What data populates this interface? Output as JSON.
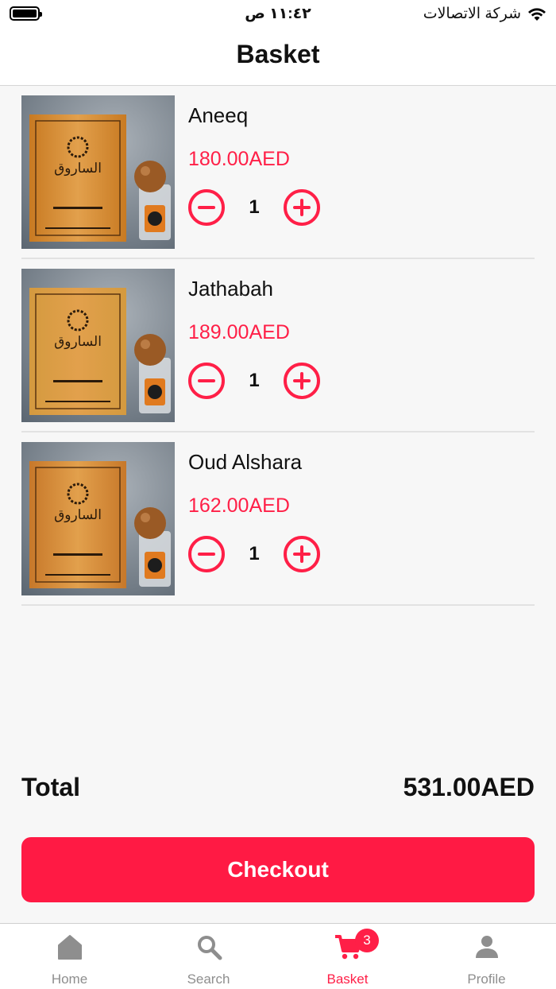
{
  "status_bar": {
    "time": "١١:٤٢ ص",
    "carrier": "شركة الاتصالات"
  },
  "header": {
    "title": "Basket"
  },
  "items": [
    {
      "name": "Aneeq",
      "price": "180.00AED",
      "quantity": "1",
      "box_brand": "ALSAROUQ",
      "box_product": "Aneeq",
      "box_color": "#c87a22"
    },
    {
      "name": "Jathabah",
      "price": "189.00AED",
      "quantity": "1",
      "box_brand": "ALSAROUQ",
      "box_product": "Jathabah",
      "box_color": "#d49a3f"
    },
    {
      "name": "Oud Alshara",
      "price": "162.00AED",
      "quantity": "1",
      "box_brand": "ALSAROUQ",
      "box_product": "Oud Alsahara",
      "box_color": "#c7782a"
    }
  ],
  "summary": {
    "total_label": "Total",
    "total_value": "531.00AED"
  },
  "checkout": {
    "label": "Checkout"
  },
  "tabbar": {
    "tabs": [
      {
        "label": "Home",
        "icon": "home-icon"
      },
      {
        "label": "Search",
        "icon": "search-icon"
      },
      {
        "label": "Basket",
        "icon": "cart-icon",
        "badge": "3"
      },
      {
        "label": "Profile",
        "icon": "person-icon"
      }
    ]
  },
  "colors": {
    "accent": "#ff1f47",
    "inactive": "#8e8e8e"
  }
}
